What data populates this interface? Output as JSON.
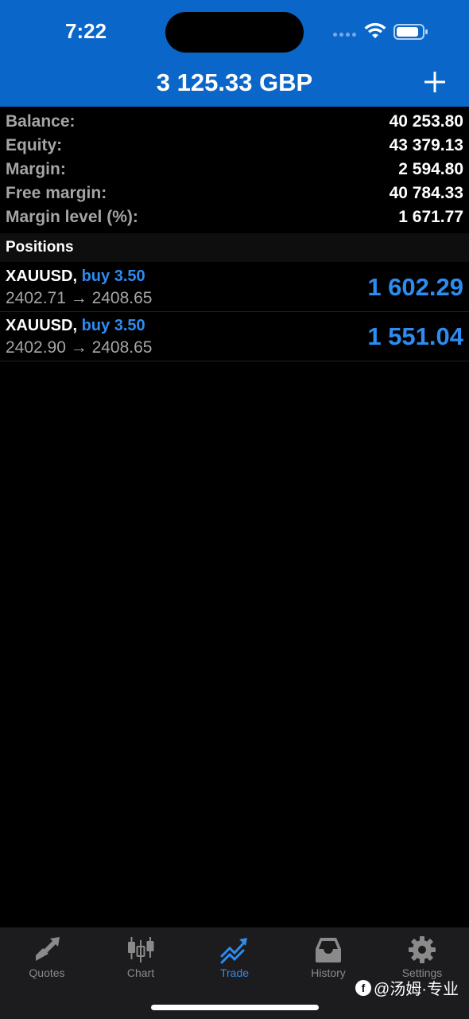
{
  "status_bar": {
    "time": "7:22"
  },
  "header": {
    "title": "3 125.33 GBP"
  },
  "summary": [
    {
      "label": "Balance:",
      "value": "40 253.80"
    },
    {
      "label": "Equity:",
      "value": "43 379.13"
    },
    {
      "label": "Margin:",
      "value": "2 594.80"
    },
    {
      "label": "Free margin:",
      "value": "40 784.33"
    },
    {
      "label": "Margin level (%):",
      "value": "1 671.77"
    }
  ],
  "positions_title": "Positions",
  "positions": [
    {
      "symbol": "XAUUSD,",
      "type": "buy 3.50",
      "prices": "2402.71 → 2408.65",
      "profit": "1 602.29"
    },
    {
      "symbol": "XAUUSD,",
      "type": "buy 3.50",
      "prices": "2402.90 → 2408.65",
      "profit": "1 551.04"
    }
  ],
  "tabs": [
    {
      "label": "Quotes",
      "icon": "quotes-icon"
    },
    {
      "label": "Chart",
      "icon": "chart-icon"
    },
    {
      "label": "Trade",
      "icon": "trade-icon",
      "active": true
    },
    {
      "label": "History",
      "icon": "history-icon"
    },
    {
      "label": "Settings",
      "icon": "settings-icon"
    }
  ],
  "watermark": {
    "text": "@汤姆·专业"
  },
  "colors": {
    "header_bg": "#0a66c8",
    "accent": "#2d8cf0",
    "label_gray": "#a5a5a5"
  }
}
